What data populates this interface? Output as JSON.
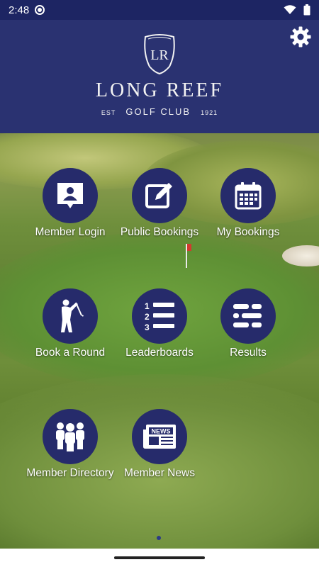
{
  "status_bar": {
    "time": "2:48",
    "icons": [
      "app-notification-icon",
      "wifi-icon",
      "battery-icon"
    ]
  },
  "header": {
    "logo_monogram": "LR",
    "brand_name": "LONG REEF",
    "est_label": "EST",
    "club_label": "GOLF CLUB",
    "year": "1921",
    "settings_icon": "gear-icon",
    "colors": {
      "header_bg": "#2a3271",
      "status_bg": "#1d2563"
    }
  },
  "menu": {
    "tile_color": "#262b6b",
    "items": [
      {
        "id": "member-login",
        "label": "Member Login",
        "icon": "member-card-icon"
      },
      {
        "id": "public-bookings",
        "label": "Public Bookings",
        "icon": "edit-pencil-icon"
      },
      {
        "id": "my-bookings",
        "label": "My Bookings",
        "icon": "calendar-icon"
      },
      {
        "id": "book-a-round",
        "label": "Book a Round",
        "icon": "golfer-icon"
      },
      {
        "id": "leaderboards",
        "label": "Leaderboards",
        "icon": "ranked-list-icon"
      },
      {
        "id": "results",
        "label": "Results",
        "icon": "list-icon"
      },
      {
        "id": "member-directory",
        "label": "Member Directory",
        "icon": "group-people-icon"
      },
      {
        "id": "member-news",
        "label": "Member News",
        "icon": "newspaper-icon"
      }
    ]
  },
  "pager": {
    "current_page": 1,
    "total_pages": 1
  }
}
